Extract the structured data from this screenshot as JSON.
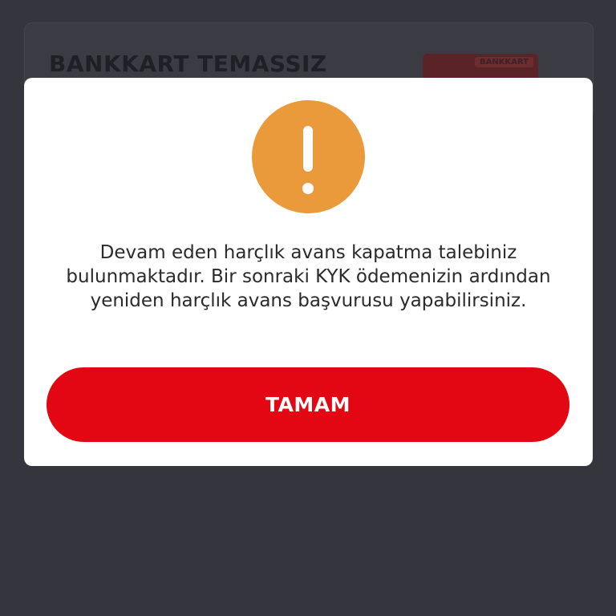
{
  "background": {
    "card_title": "BANKKART TEMASSIZ",
    "card_image_label": "BANKKART"
  },
  "dialog": {
    "icon": "exclamation-icon",
    "message": "Devam eden harçlık avans kapatma talebiniz bulunmaktadır. Bir sonraki KYK ödemenizin ardından yeniden harçlık avans başvurusu yapabilirsiniz.",
    "ok_label": "TAMAM"
  },
  "colors": {
    "overlay": "#35363d",
    "alert_icon": "#ea9a3a",
    "primary_button": "#e30613"
  }
}
